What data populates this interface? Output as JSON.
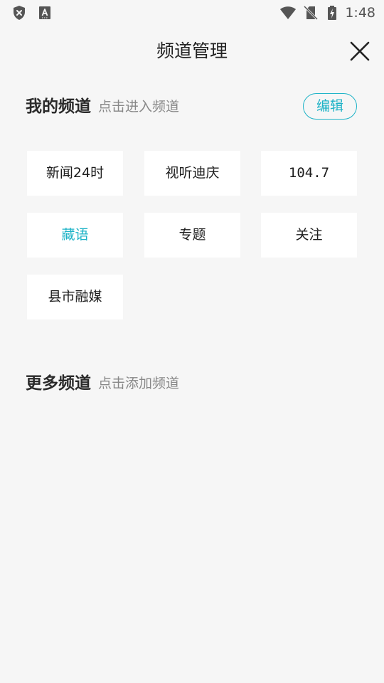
{
  "status_bar": {
    "time": "1:48",
    "icons": [
      "shield-x-icon",
      "keyboard-a-icon",
      "wifi-icon",
      "no-sim-icon",
      "battery-charging-icon"
    ]
  },
  "header": {
    "title": "频道管理",
    "close_icon": "close-icon"
  },
  "my_channels": {
    "title": "我的频道",
    "hint": "点击进入频道",
    "edit_label": "编辑",
    "accent_color": "#1eb3c7",
    "items": [
      {
        "label": "新闻24时",
        "active": false
      },
      {
        "label": "视听迪庆",
        "active": false
      },
      {
        "label": "104.7",
        "active": false
      },
      {
        "label": "藏语",
        "active": true
      },
      {
        "label": "专题",
        "active": false
      },
      {
        "label": "关注",
        "active": false
      },
      {
        "label": "县市融媒",
        "active": false
      }
    ]
  },
  "more_channels": {
    "title": "更多频道",
    "hint": "点击添加频道"
  }
}
